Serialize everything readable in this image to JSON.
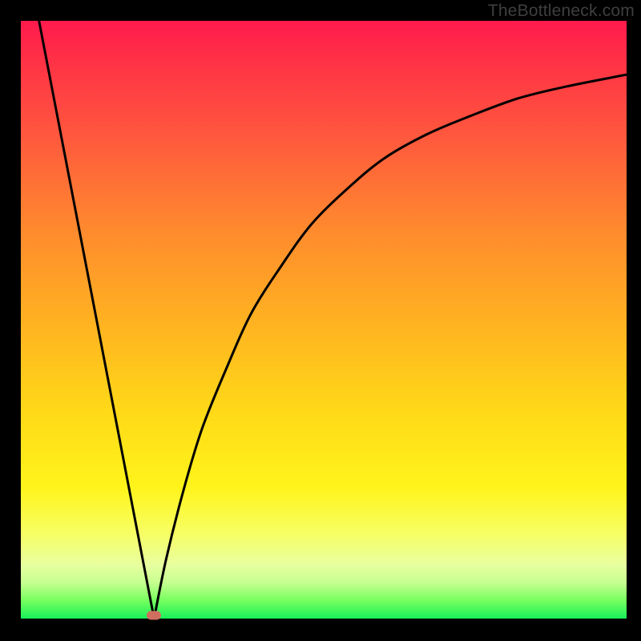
{
  "watermark": "TheBottleneck.com",
  "chart_data": {
    "type": "line",
    "title": "",
    "xlabel": "",
    "ylabel": "",
    "xlim": [
      0,
      100
    ],
    "ylim": [
      0,
      100
    ],
    "grid": false,
    "legend": false,
    "background": "rainbow-gradient-vertical",
    "series": [
      {
        "name": "left-segment",
        "x": [
          3,
          22
        ],
        "y": [
          100,
          0
        ]
      },
      {
        "name": "right-curve",
        "x": [
          22,
          24,
          27,
          30,
          34,
          38,
          43,
          48,
          54,
          60,
          67,
          74,
          82,
          90,
          100
        ],
        "y": [
          0,
          10,
          22,
          32,
          42,
          51,
          59,
          66,
          72,
          77,
          81,
          84,
          87,
          89,
          91
        ]
      }
    ],
    "marker": {
      "x": 22,
      "y": 0.5,
      "color": "#cf6f5f"
    },
    "gradient_stops": [
      {
        "pos": 0,
        "color": "#ff1a4d"
      },
      {
        "pos": 20,
        "color": "#ff5a3d"
      },
      {
        "pos": 50,
        "color": "#ffb121"
      },
      {
        "pos": 78,
        "color": "#fff41a"
      },
      {
        "pos": 94,
        "color": "#c6ff90"
      },
      {
        "pos": 100,
        "color": "#18f05a"
      }
    ]
  }
}
